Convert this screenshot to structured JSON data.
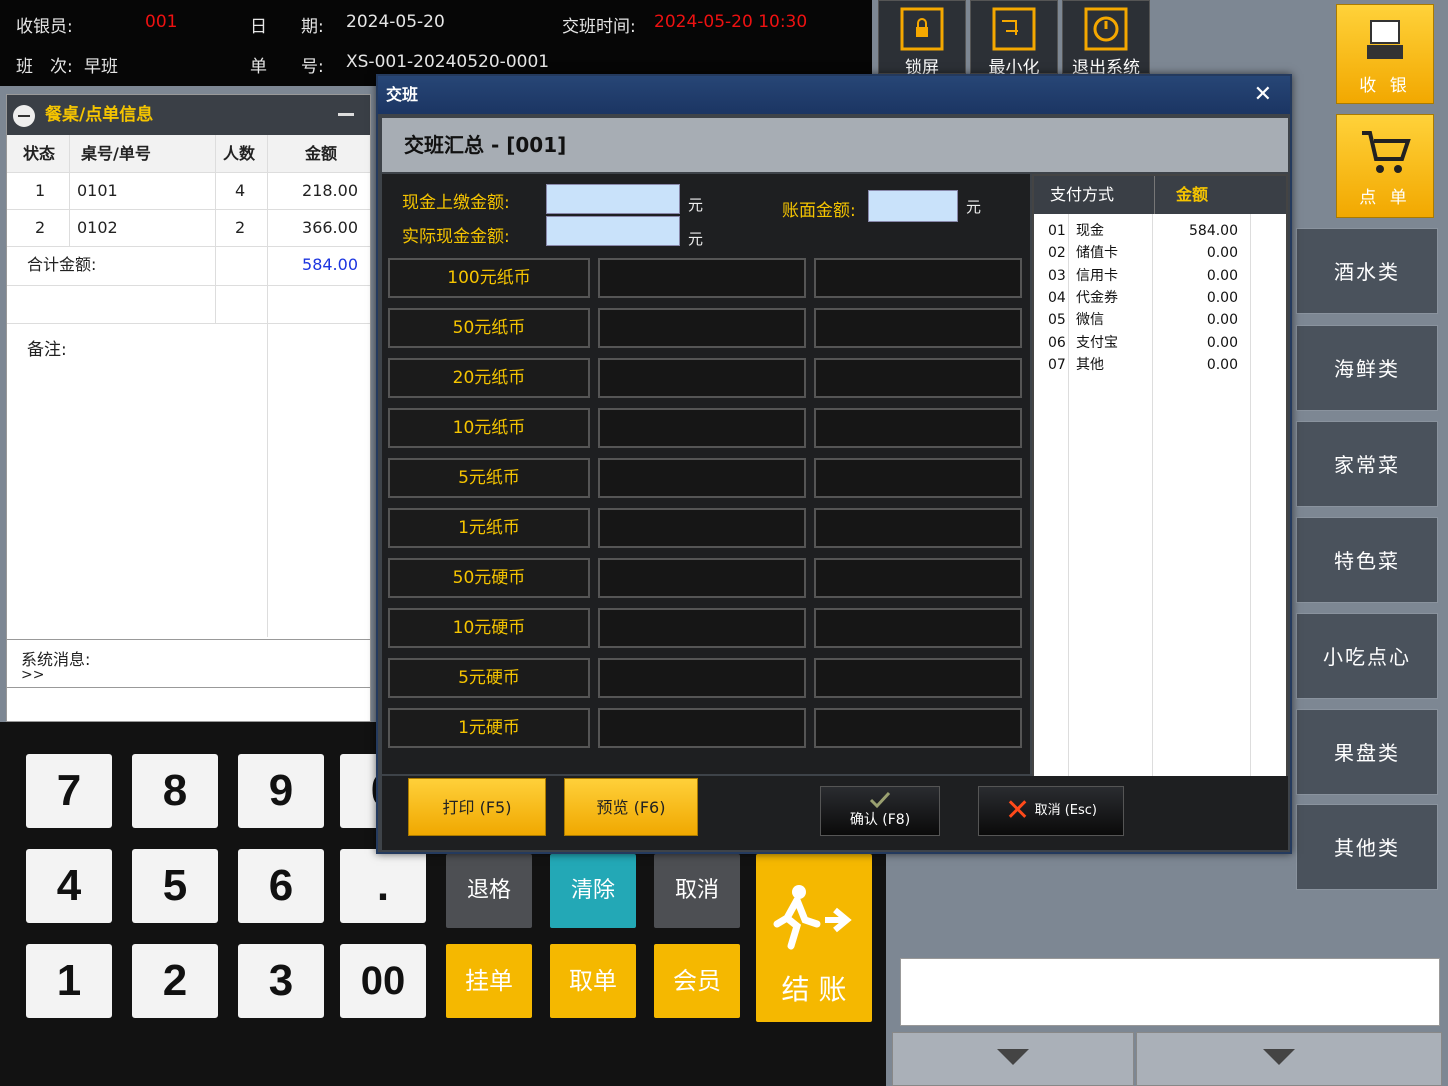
{
  "topbar": {
    "cashier_label": "收银员:",
    "cashier_value": "001",
    "date_label": "日　　期:",
    "date_value": "2024-05-20",
    "shift_time_label": "交班时间:",
    "shift_time_value": "2024-05-20  10:30",
    "shift_label": "班　次:",
    "shift_value": "早班",
    "order_label": "单　　号:",
    "order_value": "XS-001-20240520-0001"
  },
  "topbuttons": {
    "lock": "锁屏",
    "minimize": "最小化",
    "exit": "退出系统"
  },
  "sidebuttons": {
    "cashier": "收 银",
    "order": "点 单"
  },
  "leftpanel": {
    "title": "餐桌/点单信息",
    "columns": [
      "状态",
      "桌号/单号",
      "人数",
      "金额"
    ],
    "rows": [
      {
        "status": "1",
        "table": "0101",
        "people": "4",
        "amount": "218.00"
      },
      {
        "status": "2",
        "table": "0102",
        "people": "2",
        "amount": "366.00"
      }
    ],
    "total_label": "合计金额:",
    "total_value": "584.00",
    "remark_label": "备注:",
    "sysmsg_label": "系统消息:",
    "sysmsg_value": ">>"
  },
  "keypad": {
    "digits": [
      "7",
      "8",
      "9",
      "0",
      "4",
      "5",
      "6",
      ".",
      "1",
      "2",
      "3",
      "00"
    ],
    "backspace": "退格",
    "clear": "清除",
    "cancel": "取消",
    "hold": "挂单",
    "retrieve": "取单",
    "member": "会员",
    "checkout": "结 账"
  },
  "categories": [
    "酒水类",
    "海鲜类",
    "家常菜",
    "特色菜",
    "小吃点心",
    "果盘类",
    "其他类"
  ],
  "dialog": {
    "title": "交班",
    "header": "交班汇总 - [001]",
    "cash_submit_label": "现金上缴金额:",
    "actual_cash_label": "实际现金金额:",
    "book_amount_label": "账面金额:",
    "unit": "元",
    "denominations": [
      "100元纸币",
      "50元纸币",
      "20元纸币",
      "10元纸币",
      "5元纸币",
      "1元纸币",
      "50元硬币",
      "10元硬币",
      "5元硬币",
      "1元硬币"
    ],
    "pay_columns": [
      "支付方式",
      "金额"
    ],
    "payments": [
      {
        "code": "01",
        "name": "现金",
        "amount": "584.00"
      },
      {
        "code": "02",
        "name": "储值卡",
        "amount": "0.00"
      },
      {
        "code": "03",
        "name": "信用卡",
        "amount": "0.00"
      },
      {
        "code": "04",
        "name": "代金券",
        "amount": "0.00"
      },
      {
        "code": "05",
        "name": "微信",
        "amount": "0.00"
      },
      {
        "code": "06",
        "name": "支付宝",
        "amount": "0.00"
      },
      {
        "code": "07",
        "name": "其他",
        "amount": "0.00"
      }
    ],
    "print": "打印 (F5)",
    "preview": "预览 (F6)",
    "confirm": "确认 (F8)",
    "cancel": "取消 (Esc)"
  },
  "colors": {
    "accent": "#f5c400",
    "red": "#ee1111",
    "total_blue": "#1c35e0",
    "teal": "#23a8b6"
  }
}
